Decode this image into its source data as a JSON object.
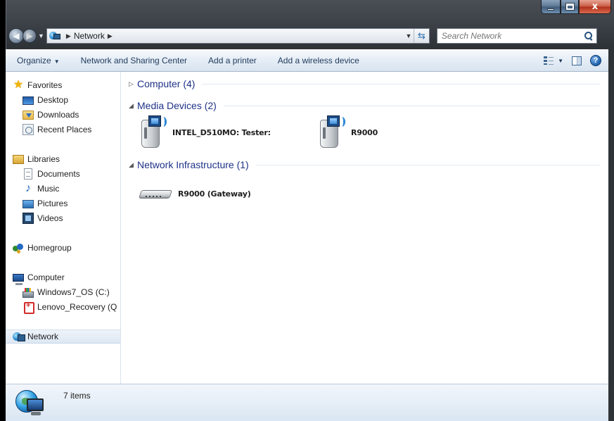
{
  "window": {
    "caption_buttons": {
      "minimize": "",
      "maximize": "",
      "close": "x"
    }
  },
  "address": {
    "icon": "network-icon",
    "crumbs": [
      "Network"
    ],
    "search_placeholder": "Search Network"
  },
  "toolbar": {
    "organize": "Organize",
    "network_sharing_center": "Network and Sharing Center",
    "add_printer": "Add a printer",
    "add_wireless_device": "Add a wireless device"
  },
  "nav": {
    "favorites": "Favorites",
    "desktop": "Desktop",
    "downloads": "Downloads",
    "recent_places": "Recent Places",
    "libraries": "Libraries",
    "documents": "Documents",
    "music": "Music",
    "pictures": "Pictures",
    "videos": "Videos",
    "homegroup": "Homegroup",
    "computer": "Computer",
    "drive_c": "Windows7_OS (C:)",
    "drive_recovery": "Lenovo_Recovery (Q",
    "network": "Network"
  },
  "groups": {
    "computer": {
      "title": "Computer (4)",
      "state": "collapsed"
    },
    "media": {
      "title": "Media Devices (2)",
      "state": "expanded",
      "items": [
        {
          "name": "INTEL_D510MO: Tester:",
          "icon": "media-device-icon"
        },
        {
          "name": "R9000",
          "icon": "media-device-icon"
        }
      ]
    },
    "infra": {
      "title": "Network Infrastructure (1)",
      "state": "expanded",
      "items": [
        {
          "name": "R9000 (Gateway)",
          "icon": "router-icon"
        }
      ]
    }
  },
  "status": {
    "count_text": "7 items"
  },
  "colors": {
    "group_title": "#1e3287",
    "toolbar_text": "#1e395b",
    "status_bar_bg": "#dae6f3"
  }
}
